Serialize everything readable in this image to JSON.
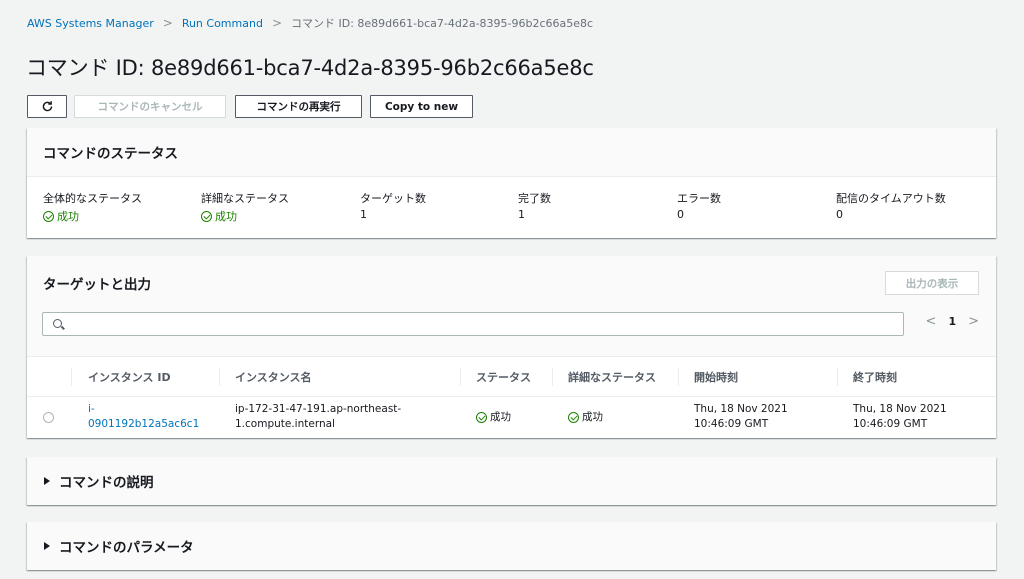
{
  "breadcrumb": {
    "items": [
      "AWS Systems Manager",
      "Run Command"
    ],
    "current": "コマンド ID: 8e89d661-bca7-4d2a-8395-96b2c66a5e8c"
  },
  "page": {
    "title": "コマンド ID: 8e89d661-bca7-4d2a-8395-96b2c66a5e8c"
  },
  "toolbar": {
    "refresh_icon": "refresh-icon",
    "cancel_label": "コマンドのキャンセル",
    "rerun_label": "コマンドの再実行",
    "copy_label": "Copy to new"
  },
  "status": {
    "title": "コマンドのステータス",
    "overall_label": "全体的なステータス",
    "overall_value": "成功",
    "detail_label": "詳細なステータス",
    "detail_value": "成功",
    "targets_label": "ターゲット数",
    "targets_value": "1",
    "completed_label": "完了数",
    "completed_value": "1",
    "errors_label": "エラー数",
    "errors_value": "0",
    "timeouts_label": "配信のタイムアウト数",
    "timeouts_value": "0"
  },
  "targets": {
    "title": "ターゲットと出力",
    "show_output_label": "出力の表示",
    "search_placeholder": "",
    "page_number": "1",
    "columns": [
      "インスタンス ID",
      "インスタンス名",
      "ステータス",
      "詳細なステータス",
      "開始時刻",
      "終了時刻"
    ],
    "rows": [
      {
        "instance_id_line1": "i-",
        "instance_id_line2": "0901192b12a5ac6c1",
        "instance_name_line1": "ip-172-31-47-191.ap-northeast-",
        "instance_name_line2": "1.compute.internal",
        "status": "成功",
        "detail_status": "成功",
        "start_line1": "Thu, 18 Nov 2021",
        "start_line2": "10:46:09 GMT",
        "end_line1": "Thu, 18 Nov 2021",
        "end_line2": "10:46:09 GMT"
      }
    ]
  },
  "description": {
    "title": "コマンドの説明"
  },
  "parameters": {
    "title": "コマンドのパラメータ"
  },
  "colors": {
    "link": "#0073bb",
    "success": "#1d8102",
    "background": "#f2f3f3"
  }
}
